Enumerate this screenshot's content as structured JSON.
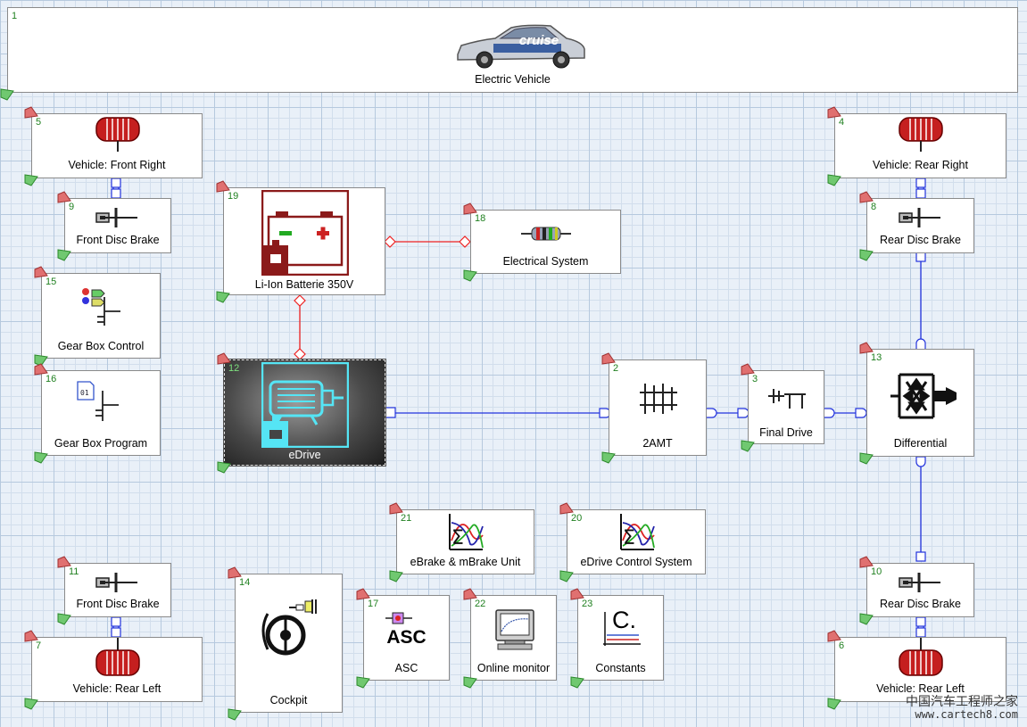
{
  "top_component": {
    "number": "1",
    "label": "Electric Vehicle",
    "badge": "cruise"
  },
  "components": {
    "c5": {
      "number": "5",
      "label": "Vehicle: Front Right"
    },
    "c9": {
      "number": "9",
      "label": "Front Disc Brake"
    },
    "c15": {
      "number": "15",
      "label": "Gear Box Control"
    },
    "c16": {
      "number": "16",
      "label": "Gear Box Program"
    },
    "c19": {
      "number": "19",
      "label": "Li-Ion Batterie 350V"
    },
    "c18": {
      "number": "18",
      "label": "Electrical System"
    },
    "c12": {
      "number": "12",
      "label": "eDrive"
    },
    "c2": {
      "number": "2",
      "label": "2AMT"
    },
    "c3": {
      "number": "3",
      "label": "Final Drive"
    },
    "c13": {
      "number": "13",
      "label": "Differential"
    },
    "c4": {
      "number": "4",
      "label": "Vehicle: Rear Right"
    },
    "c8": {
      "number": "8",
      "label": "Rear Disc Brake"
    },
    "c21": {
      "number": "21",
      "label": "eBrake & mBrake Unit"
    },
    "c20": {
      "number": "20",
      "label": "eDrive Control System"
    },
    "c11": {
      "number": "11",
      "label": "Front Disc Brake"
    },
    "c7": {
      "number": "7",
      "label": "Vehicle: Rear Left"
    },
    "c14": {
      "number": "14",
      "label": "Cockpit"
    },
    "c17": {
      "number": "17",
      "label": "ASC",
      "icon_text": "ASC"
    },
    "c22": {
      "number": "22",
      "label": "Online monitor"
    },
    "c23": {
      "number": "23",
      "label": "Constants",
      "icon_text": "C."
    },
    "c10": {
      "number": "10",
      "label": "Rear Disc Brake"
    },
    "c6": {
      "number": "6",
      "label": "Vehicle: Rear Left"
    }
  },
  "watermark": {
    "line1": "中国汽车工程师之家",
    "line2": "www.cartech8.com"
  },
  "colors": {
    "mechanical": "#2233dd",
    "electrical": "#ee2222",
    "flag_top": "#e07070",
    "flag_bottom": "#70c870",
    "component_number": "#208020"
  }
}
